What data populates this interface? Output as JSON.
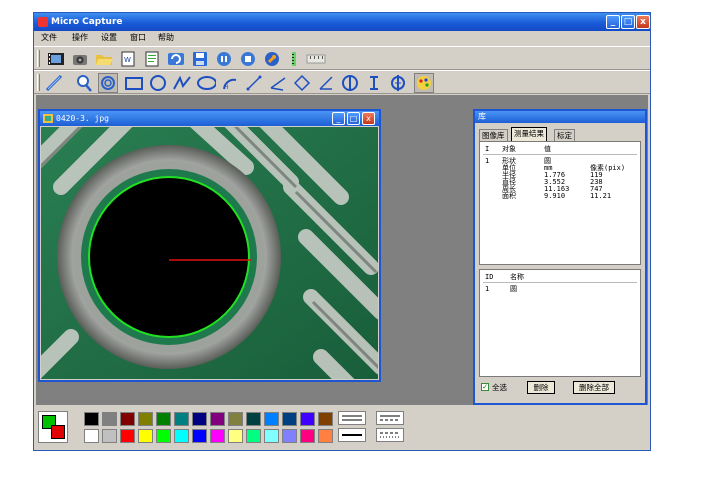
{
  "app": {
    "title": "Micro Capture",
    "window_buttons": [
      "_",
      "□",
      "x"
    ]
  },
  "menu": [
    "文件",
    "操作",
    "设置",
    "窗口",
    "帮助"
  ],
  "toolbar1": [
    "video-icon",
    "camera-icon",
    "open-folder-icon",
    "document-icon",
    "new-document-icon",
    "rotate-icon",
    "save-icon",
    "pause-icon",
    "stop-icon",
    "settings-icon",
    "ruler-icon",
    "scale-icon"
  ],
  "toolbar2": [
    "line-tool-icon",
    "zoom-icon",
    "circle-select-icon",
    "rectangle-icon",
    "circle-icon",
    "polyline-icon",
    "ellipse-icon",
    "arc-icon",
    "angle-icon",
    "angle2-icon",
    "angle3-icon",
    "perpendicular-icon",
    "circle-center-icon",
    "parallel-icon",
    "diamond-icon",
    "palette-icon"
  ],
  "image_window": {
    "title": "0420-3. jpg",
    "buttons": [
      "_",
      "□",
      "x"
    ]
  },
  "library": {
    "title": "库",
    "tabs": [
      "图像库",
      "测量结果",
      "标定"
    ],
    "active_tab": 1,
    "results_header": [
      "I",
      "对象",
      "值"
    ],
    "results_rows": [
      [
        "1",
        "形状",
        "圆",
        ""
      ],
      [
        "",
        "单位",
        "mm",
        "像素(pix)"
      ],
      [
        "",
        "半径",
        "1.776",
        "119"
      ],
      [
        "",
        "直径",
        "3.552",
        "238"
      ],
      [
        "",
        "周长",
        "11.163",
        "747"
      ],
      [
        "",
        "面积",
        "9.910",
        "11.21"
      ]
    ],
    "list_header": [
      "ID",
      "名称"
    ],
    "list_rows": [
      [
        "1",
        "圆"
      ]
    ],
    "select_all": "全选",
    "delete_label": "删除",
    "delete_all_label": "删除全部"
  },
  "palette": {
    "foreground": "#00c000",
    "background": "#e00000",
    "row1": [
      "#000000",
      "#808080",
      "#800000",
      "#808000",
      "#008000",
      "#008080",
      "#000080",
      "#800080",
      "#808040",
      "#004040",
      "#0080ff",
      "#004080",
      "#4000ff",
      "#804000"
    ],
    "row2": [
      "#ffffff",
      "#c0c0c0",
      "#ff0000",
      "#ffff00",
      "#00ff00",
      "#00ffff",
      "#0000ff",
      "#ff00ff",
      "#ffff80",
      "#00ff80",
      "#80ffff",
      "#8080ff",
      "#ff0080",
      "#ff8040"
    ]
  },
  "colors": {
    "measure_circle": "#22e022",
    "radius_line": "#e01010"
  }
}
